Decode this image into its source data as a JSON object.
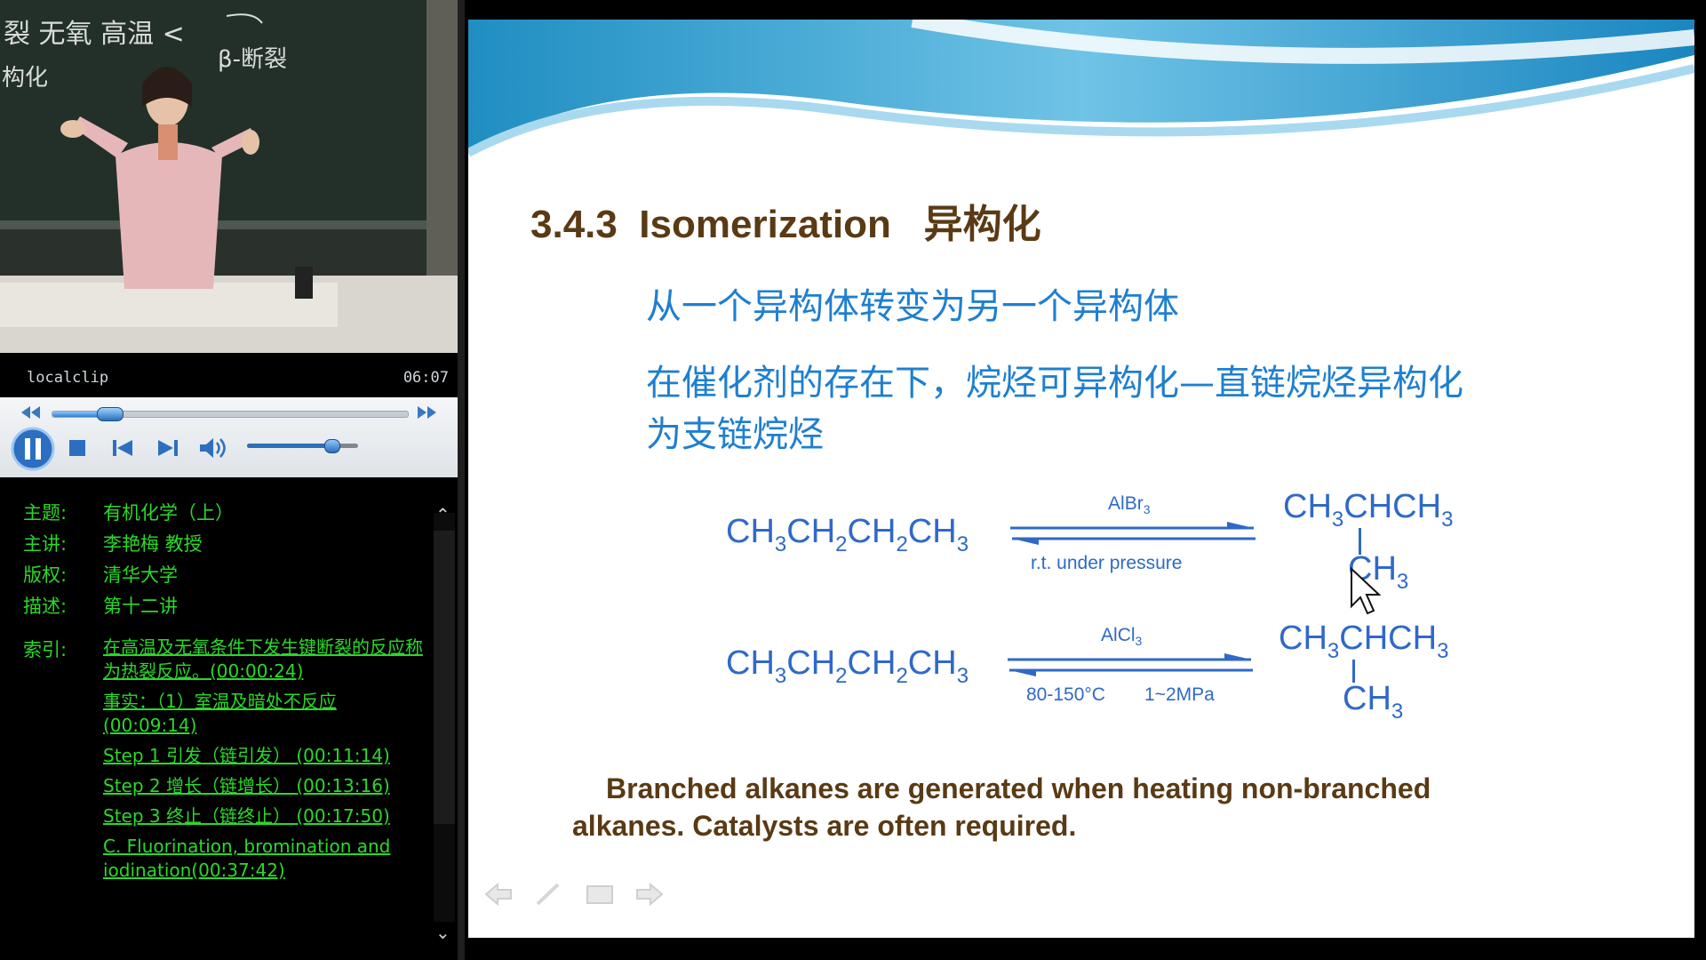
{
  "player": {
    "clip_name": "localclip",
    "time": "06:07",
    "progress": 0.16,
    "volume": 0.76,
    "controls": [
      "pause",
      "stop",
      "previous",
      "next",
      "volume"
    ]
  },
  "info": {
    "topic_label": "主题:",
    "topic_value": "有机化学（上）",
    "lecturer_label": "主讲:",
    "lecturer_value": "李艳梅 教授",
    "copyright_label": "版权:",
    "copyright_value": "清华大学",
    "desc_label": "描述:",
    "desc_value": "第十二讲",
    "index_label": "索引:",
    "index": [
      "在高温及无氧条件下发生键断裂的反应称为热裂反应。(00:00:24)",
      "事实：（1）室温及暗处不反应 (00:09:14)",
      "Step 1 引发（链引发） (00:11:14)",
      "Step 2 增长（链增长） (00:13:16)",
      "Step 3 终止（链终止） (00:17:50)",
      "C. Fluorination, bromination and iodination(00:37:42)"
    ]
  },
  "blackboard": {
    "line1": "裂  无氧 高温 <",
    "line2": "β-断裂",
    "line3": "构化"
  },
  "slide": {
    "title": "3.4.3  Isomerization   异构化",
    "line1": "从一个异构体转变为另一个异构体",
    "line2a": "在催化剂的存在下，烷烃可异构化—直链烷烃异构化",
    "line2b": "为支链烷烃",
    "reaction1": {
      "reactant": "CH3CH2CH2CH3",
      "catalyst": "AlBr3",
      "condition": "r.t.  under pressure",
      "product_main": "CH3CHCH3",
      "product_branch": "CH3"
    },
    "reaction2": {
      "reactant": "CH3CH2CH2CH3",
      "catalyst": "AlCl3",
      "condition_temp": "80-150°C",
      "condition_pressure": "1~2MPa",
      "product_main": "CH3CHCH3",
      "product_branch": "CH3"
    },
    "note_line1": "Branched alkanes are  generated when heating non-branched",
    "note_line2": "alkanes. Catalysts are often required."
  },
  "colors": {
    "info_text": "#2bd82b",
    "slide_chinese": "#1f7fd0",
    "slide_chem": "#2f69c8",
    "slide_title": "#5a3a14"
  }
}
